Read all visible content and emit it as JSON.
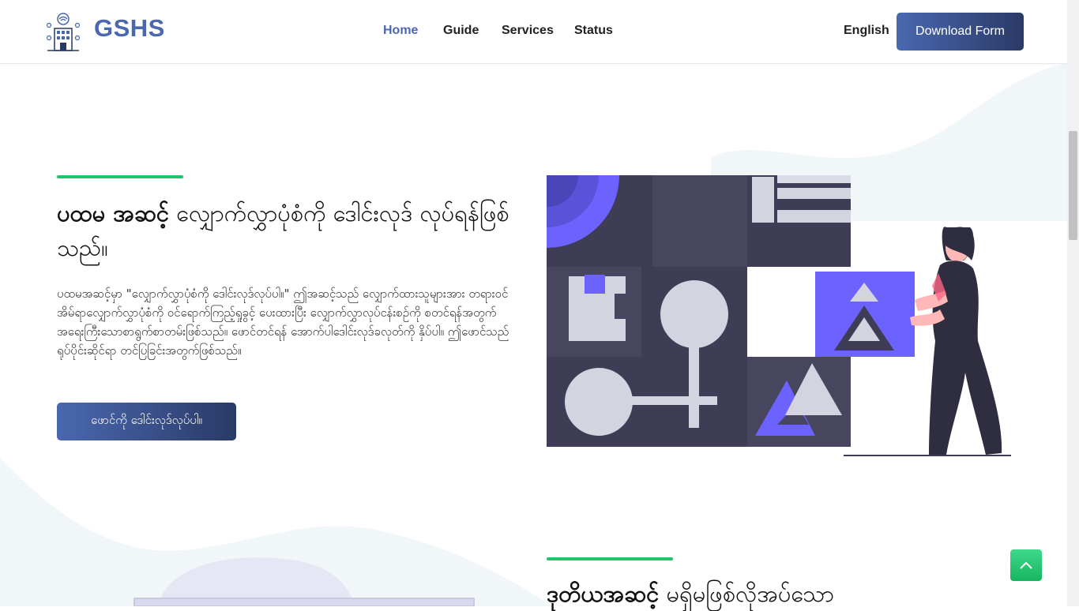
{
  "brand": {
    "name": "GSHS"
  },
  "nav": {
    "items": [
      {
        "label": "Home",
        "active": true
      },
      {
        "label": "Guide",
        "active": false
      },
      {
        "label": "Services",
        "active": false
      },
      {
        "label": "Status",
        "active": false
      }
    ]
  },
  "header": {
    "language": "English",
    "download_button": "Download Form"
  },
  "step1": {
    "heading_bold": "ပထမ အဆင့်",
    "heading_rest": " လျှောက်လွှာပုံစံကို ဒေါင်းလုဒ် လုပ်ရန်ဖြစ်သည်။",
    "description": "ပထမအဆင့်မှာ \"လျှောက်လွှာပုံစံကို ဒေါင်းလုဒ်လုပ်ပါ။\" ဤအဆင့်သည် လျှောက်ထားသူများအား တရားဝင်အိမ်ရာလျှောက်လွှာပုံစံကို ဝင်ရောက်ကြည့်ရှုခွင့် ပေးထားပြီး လျှောက်လွှာလုပ်ငန်းစဉ်ကို စတင်ရန်အတွက် အရေးကြီးသောစာရွက်စာတမ်းဖြစ်သည်။ ဖောင်တင်ရန် အောက်ပါဒေါင်းလုဒ်ခလုတ်ကို နှိပ်ပါ။ ဤဖောင်သည် ရုပ်ပိုင်းဆိုင်ရာ တင်ပြခြင်းအတွက်ဖြစ်သည်။",
    "button": "ဖောင်ကို ဒေါင်းလုဒ်လုပ်ပါ။"
  },
  "step2": {
    "heading_bold": "ဒုတိယအဆင့်",
    "heading_rest": " မရှိမဖြစ်လိုအပ်သော"
  },
  "colors": {
    "brand_blue": "#4a68b0",
    "dark_navy": "#2a3a66",
    "accent_green": "#22c46b",
    "illustration_purple": "#6c63ff",
    "illustration_dark": "#3f3d56"
  }
}
